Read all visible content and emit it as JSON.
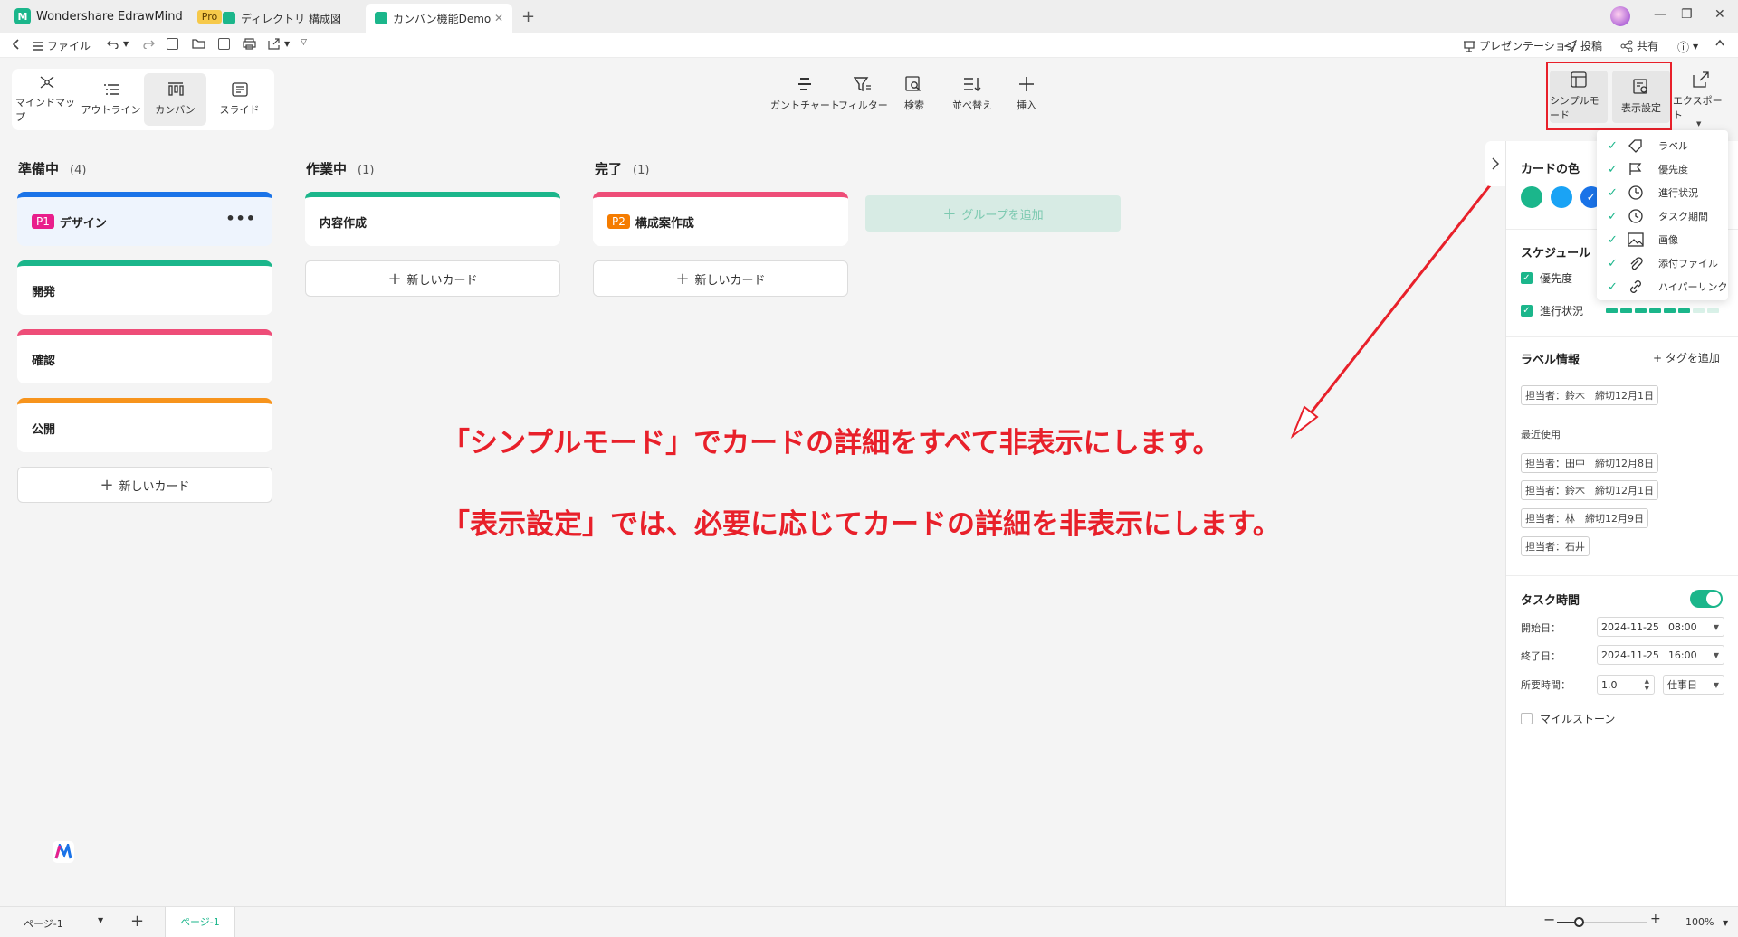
{
  "titlebar": {
    "app_name": "Wondershare EdrawMind",
    "pro_badge": "Pro",
    "tabs": [
      {
        "label": "ディレクトリ 構成図"
      },
      {
        "label": "カンバン機能Demo"
      }
    ]
  },
  "menubar": {
    "file": "ファイル",
    "presentation": "プレゼンテーション",
    "post": "投稿",
    "share": "共有"
  },
  "toolbar": {
    "views": [
      {
        "label": "マインドマップ"
      },
      {
        "label": "アウトライン"
      },
      {
        "label": "カンバン"
      },
      {
        "label": "スライド"
      }
    ],
    "active_view": "カンバン",
    "tools": [
      {
        "label": "ガントチャート"
      },
      {
        "label": "フィルター"
      },
      {
        "label": "検索"
      },
      {
        "label": "並べ替え"
      },
      {
        "label": "挿入"
      }
    ],
    "simple_mode": "シンプルモード",
    "display_settings": "表示設定",
    "export": "エクスポート"
  },
  "board": {
    "columns": [
      {
        "title": "準備中",
        "count": "(4)",
        "cards": [
          {
            "label": "P1",
            "title": "デザイン",
            "color": "#1a73e8",
            "prio_color": "#e91e8c"
          },
          {
            "title": "開発",
            "color": "#1bb68b"
          },
          {
            "title": "確認",
            "color": "#ee4d78"
          },
          {
            "title": "公開",
            "color": "#f7941d"
          }
        ]
      },
      {
        "title": "作業中",
        "count": "(1)",
        "cards": [
          {
            "title": "内容作成",
            "color": "#1bb68b"
          }
        ]
      },
      {
        "title": "完了",
        "count": "(1)",
        "cards": [
          {
            "label": "P2",
            "title": "構成案作成",
            "color": "#ee4d78",
            "prio_color": "#f57c00"
          }
        ]
      }
    ],
    "new_card": "新しいカード",
    "add_group": "グループを追加"
  },
  "annotations": {
    "line1": "「シンプルモード」でカードの詳細をすべて非表示にします。",
    "line2": "「表示設定」では、必要に応じてカードの詳細を非表示にします。"
  },
  "display_menu": {
    "items": [
      {
        "label": "ラベル"
      },
      {
        "label": "優先度"
      },
      {
        "label": "進行状況"
      },
      {
        "label": "タスク期間"
      },
      {
        "label": "画像"
      },
      {
        "label": "添付ファイル"
      },
      {
        "label": "ハイパーリンク"
      }
    ]
  },
  "panel": {
    "card_color_title": "カードの色",
    "swatches": [
      "#1bb68b",
      "#1aa3f5",
      "#1a73e8"
    ],
    "schedule_title": "スケジュール",
    "priority": "優先度",
    "progress": "進行状況",
    "progress_value": 0.75,
    "label_info_title": "ラベル情報",
    "add_tag": "+ タグを追加",
    "current_tag": "担当者：鈴木　締切12月1日",
    "recent_title": "最近使用",
    "recent_tags": [
      "担当者：田中　締切12月8日",
      "担当者：鈴木　締切12月1日",
      "担当者：林　締切12月9日",
      "担当者：石井"
    ],
    "task_time_title": "タスク時間",
    "start_label": "開始日：",
    "start_date": "2024-11-25",
    "start_time": "08:00",
    "end_label": "終了日：",
    "end_date": "2024-11-25",
    "end_time": "16:00",
    "duration_label": "所要時間：",
    "duration_value": "1.0",
    "duration_unit": "仕事日",
    "milestone": "マイルストーン"
  },
  "statusbar": {
    "page_select": "ページ-1",
    "page_tab": "ページ-1",
    "zoom": "100%"
  },
  "colors": {
    "accent": "#1bb68b",
    "annotation_red": "#e8202a"
  }
}
